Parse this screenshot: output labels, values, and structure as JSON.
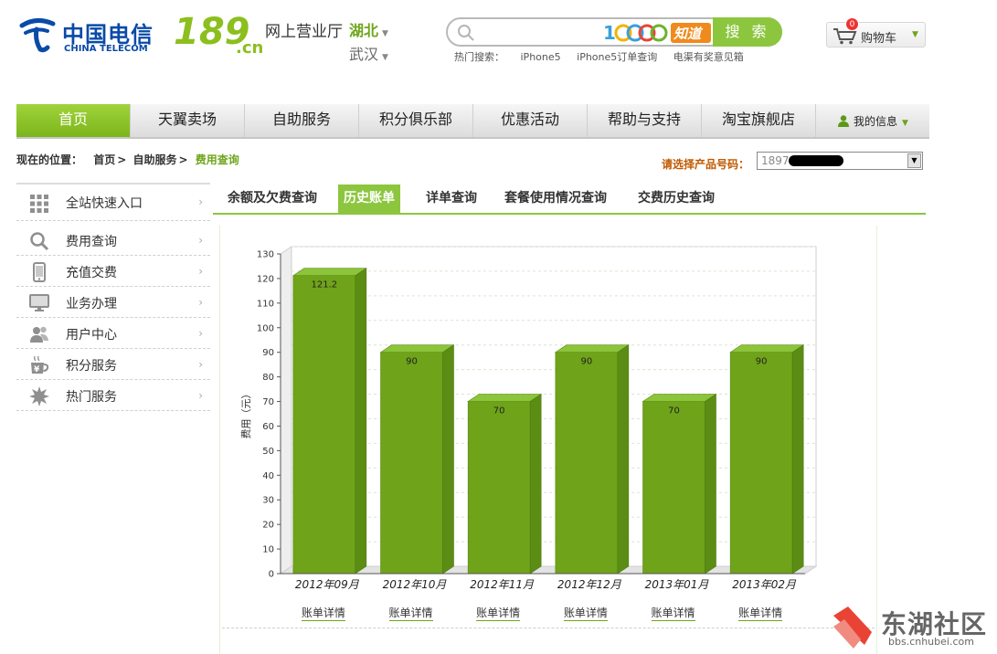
{
  "header": {
    "logo_cn": "中国电信",
    "logo_en": "CHINA TELECOM",
    "brand_num": "189",
    "brand_suffix": ".cn",
    "store_name": "网上营业厅",
    "region": "湖北",
    "city": "武汉",
    "search": {
      "placeholder": "",
      "button_label": "搜 索",
      "partner_logo": "10000知道"
    },
    "hot_search": {
      "label": "热门搜索：",
      "items": [
        "iPhone5",
        "iPhone5订单查询",
        "电渠有奖意见箱"
      ]
    },
    "cart": {
      "label": "购物车",
      "count": "0"
    }
  },
  "nav": {
    "items": [
      "首页",
      "天翼卖场",
      "自助服务",
      "积分俱乐部",
      "优惠活动",
      "帮助与支持",
      "淘宝旗舰店"
    ],
    "active_index": 0,
    "my_info": "我的信息"
  },
  "breadcrumb": {
    "label": "现在的位置：",
    "items": [
      "首页",
      "自助服务"
    ],
    "separator": ">",
    "current": "费用查询"
  },
  "product_select": {
    "label": "请选择产品号码：",
    "value": "1897"
  },
  "sidebar": {
    "items": [
      {
        "label": "全站快速入口",
        "icon": "grid-icon"
      },
      {
        "label": "费用查询",
        "icon": "magnifier-icon"
      },
      {
        "label": "充值交费",
        "icon": "phone-icon"
      },
      {
        "label": "业务办理",
        "icon": "monitor-icon"
      },
      {
        "label": "用户中心",
        "icon": "users-icon"
      },
      {
        "label": "积分服务",
        "icon": "yen-cup-icon"
      },
      {
        "label": "热门服务",
        "icon": "starburst-icon"
      }
    ]
  },
  "tabs": {
    "items": [
      "余额及欠费查询",
      "历史账单",
      "详单查询",
      "套餐使用情况查询",
      "交费历史查询"
    ],
    "active_index": 1
  },
  "chart_data": {
    "type": "bar",
    "categories": [
      "2012年09月",
      "2012年10月",
      "2012年11月",
      "2012年12月",
      "2013年01月",
      "2013年02月"
    ],
    "values": [
      121.2,
      90,
      70,
      90,
      70,
      90
    ],
    "value_labels": [
      "121.2",
      "90",
      "70",
      "90",
      "70",
      "90"
    ],
    "ylabel": "费用（元）",
    "ylim": [
      0,
      130
    ],
    "yticks": [
      0,
      10,
      20,
      30,
      40,
      50,
      60,
      70,
      80,
      90,
      100,
      110,
      120,
      130
    ],
    "grid": true,
    "bar_color": "#6fa31a",
    "style": "3d"
  },
  "detail_link_label": "账单详情",
  "watermark": {
    "title": "东湖社区",
    "url": "bbs.cnhubei.com"
  },
  "colors": {
    "accent_green": "#8cc63f",
    "brand_blue": "#0a4aa8",
    "highlight_orange": "#c05a00"
  }
}
